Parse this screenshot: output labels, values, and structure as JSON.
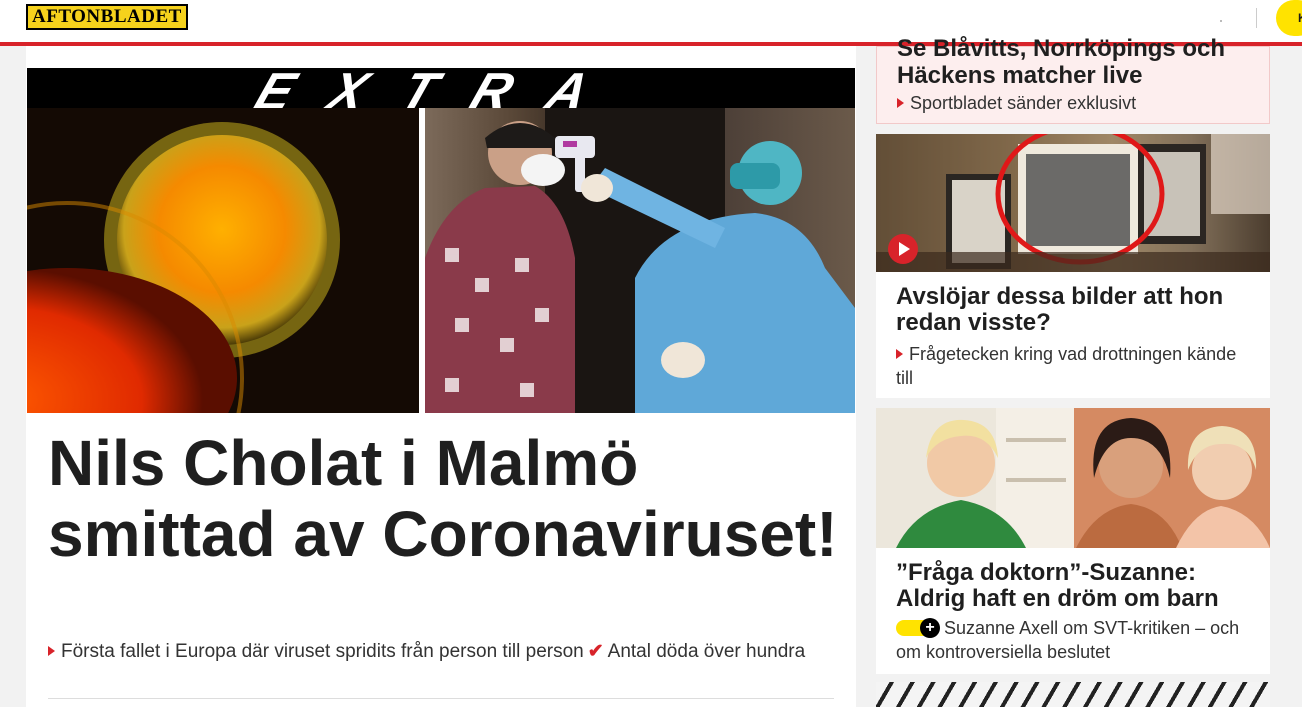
{
  "header": {
    "logo_text": "AFTONBLADET",
    "login_label": "K",
    "accent_color": "#d8232a",
    "logo_color": "#f6d21c"
  },
  "main_story": {
    "banner": "EXTRA",
    "headline": "Nils Cholat i Malmö smittad av Coronaviruset!",
    "lead_1": "Första fallet i Europa där viruset spridits från person till person",
    "lead_2": "Antal döda över hundra"
  },
  "side_stories": [
    {
      "title": "Se Blåvitts, Norrköpings och Häckens matcher live",
      "subtitle": "Sportbladet sänder exklusivt"
    },
    {
      "title": "Avslöjar dessa bilder att hon redan visste?",
      "subtitle": "Frågetecken kring vad drottningen kände till"
    },
    {
      "title": "”Fråga doktorn”-Suzanne: Aldrig haft en dröm om barn",
      "subtitle": "Suzanne Axell om SVT-kritiken – och om kontroversiella beslutet"
    }
  ],
  "icons": [
    "play-icon",
    "arrow-icon",
    "check-icon",
    "plus-icon"
  ]
}
